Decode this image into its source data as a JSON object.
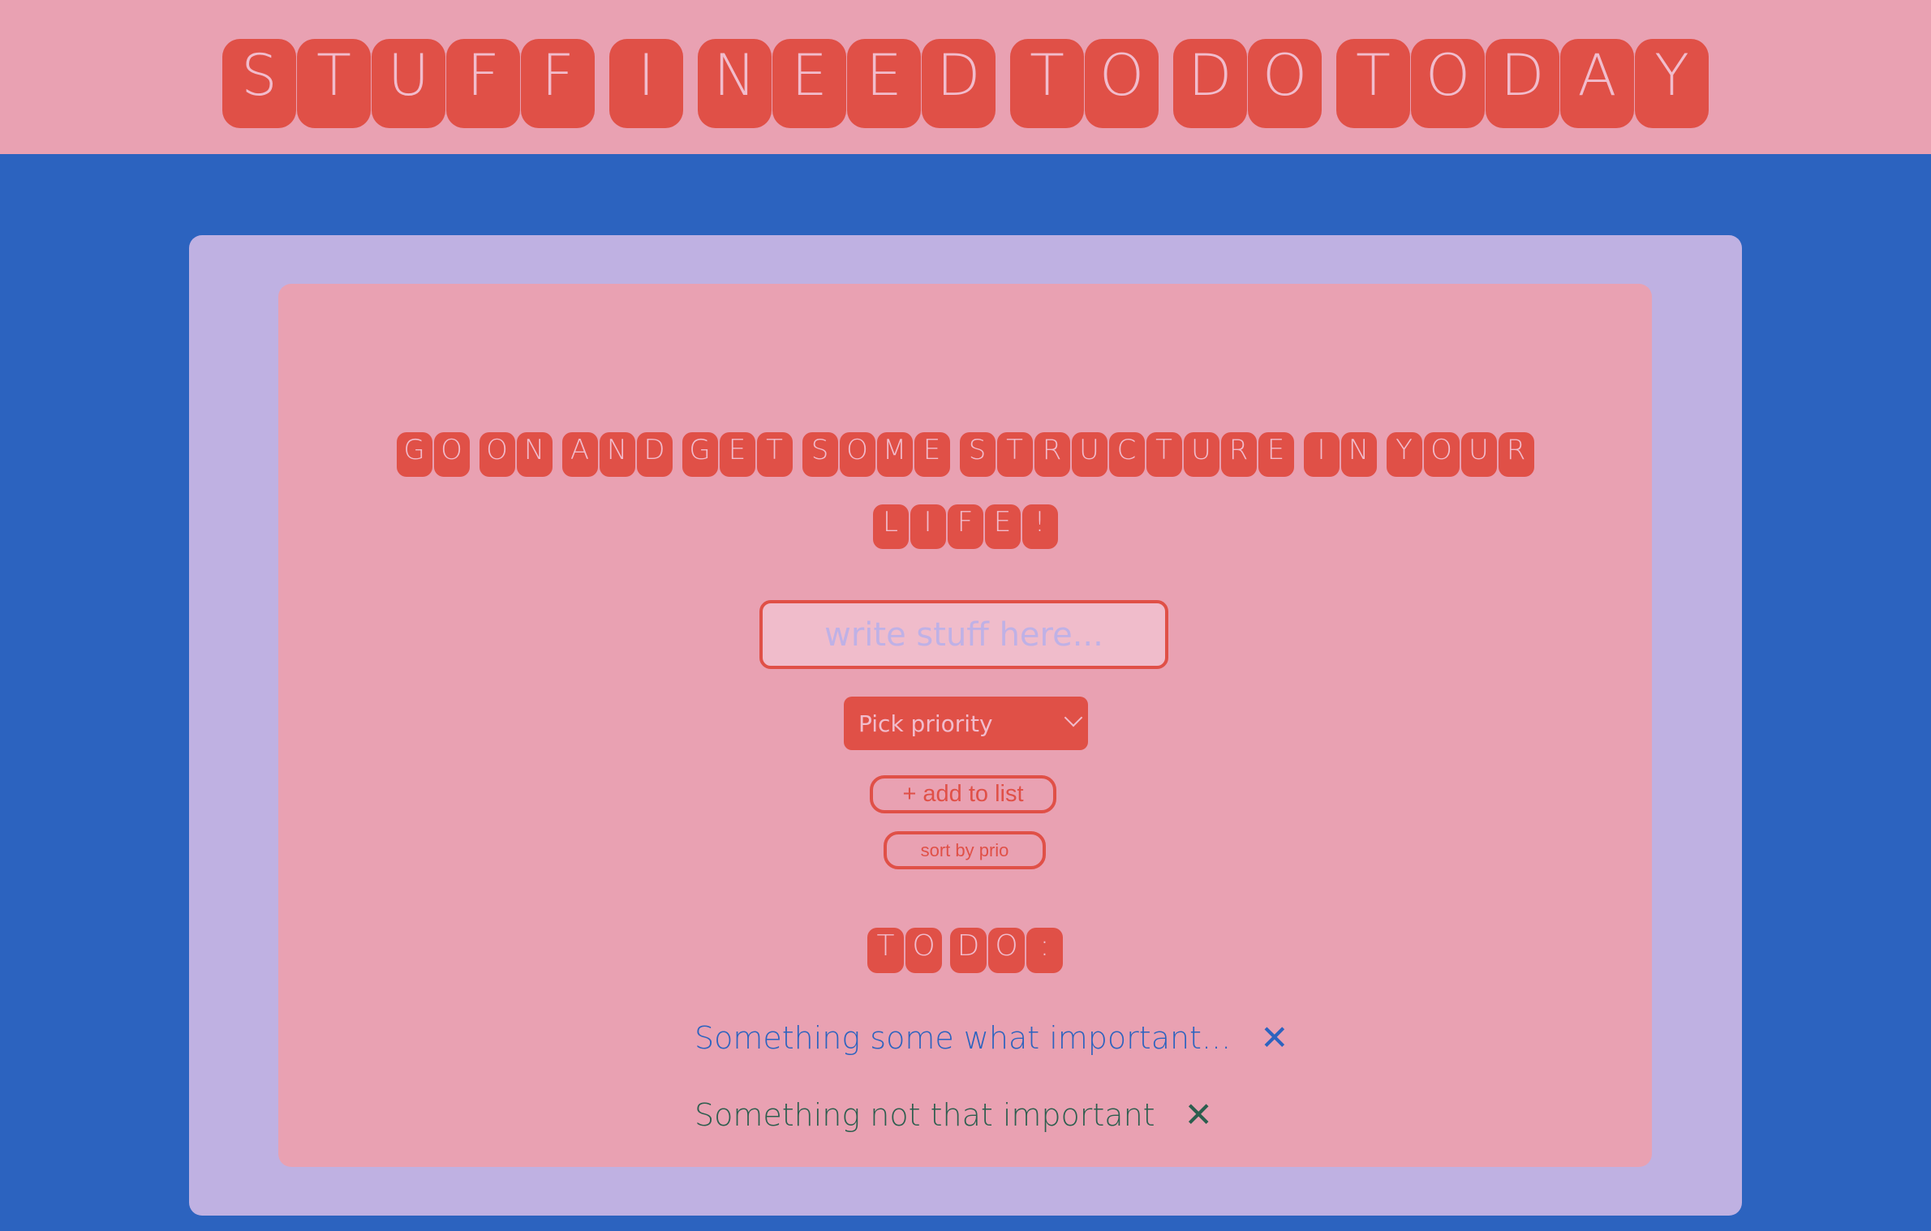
{
  "header": {
    "title_words": [
      "STUFF",
      "I",
      "NEED",
      "TO",
      "DO",
      "TODAY"
    ]
  },
  "main": {
    "subtitle_line1": [
      "GO",
      "ON",
      "AND",
      "GET",
      "SOME",
      "STRUCTURE",
      "IN",
      "YOUR"
    ],
    "subtitle_line2": [
      "LIFE!"
    ],
    "input": {
      "placeholder": "write stuff here...",
      "value": ""
    },
    "priority_select": {
      "selected": "Pick priority"
    },
    "add_button_label": "+ add to list",
    "sort_button_label": "sort by prio",
    "todo_heading_words": [
      "TO",
      "DO:"
    ],
    "todos": [
      {
        "text": "Something some what important...",
        "delete_symbol": "✕",
        "color": "#2c63bf"
      },
      {
        "text": "Something not that important",
        "delete_symbol": "✕",
        "color": "#2c5e4e"
      }
    ]
  },
  "colors": {
    "background": "#2c63bf",
    "header_bg": "#e9a1b2",
    "panel_outer": "#bfb1e2",
    "panel_inner": "#e9a1b2",
    "accent": "#e05047",
    "tile_text": "#f1bccc"
  }
}
